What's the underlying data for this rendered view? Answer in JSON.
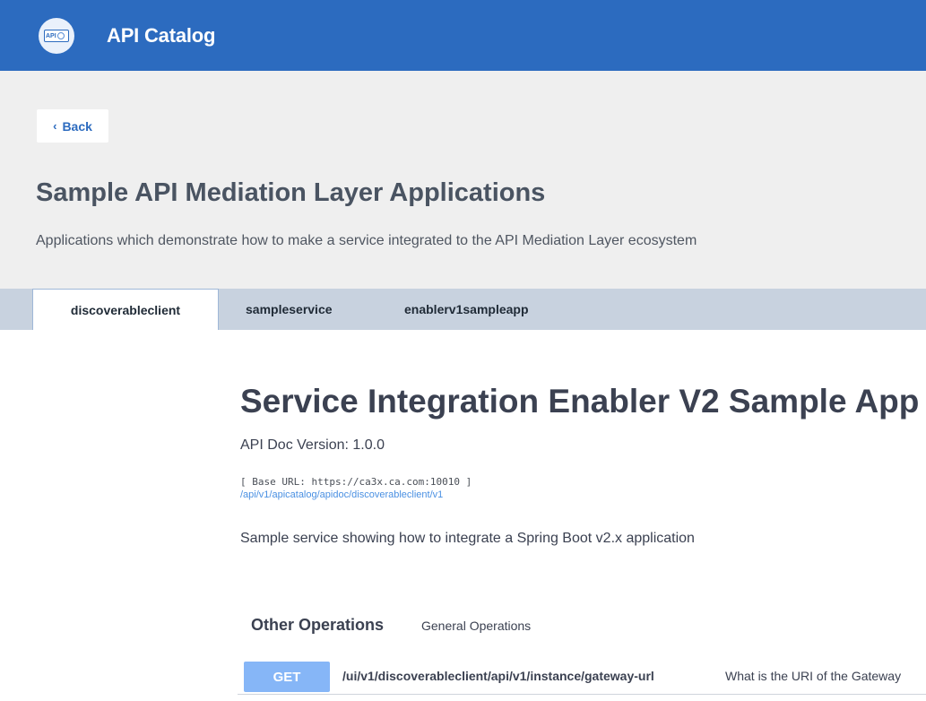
{
  "header": {
    "app_title": "API Catalog",
    "logo_text": "API",
    "bg_color": "#2c6bbf"
  },
  "nav": {
    "back_label": "Back",
    "back_icon": "chevron-left-icon"
  },
  "catalog": {
    "title": "Sample API Mediation Layer Applications",
    "description": "Applications which demonstrate how to make a service integrated to the API Mediation Layer ecosystem"
  },
  "tabs": [
    {
      "label": "discoverableclient",
      "active": true
    },
    {
      "label": "sampleservice",
      "active": false
    },
    {
      "label": "enablerv1sampleapp",
      "active": false
    }
  ],
  "service": {
    "title": "Service Integration Enabler V2 Sample App",
    "doc_version": "API Doc Version: 1.0.0",
    "base_url": "[ Base URL: https://ca3x.ca.com:10010 ]",
    "doc_link": "/api/v1/apicatalog/apidoc/discoverableclient/v1",
    "description": "Sample service showing how to integrate a Spring Boot v2.x application"
  },
  "operations_section": {
    "title": "Other Operations",
    "subtitle": "General Operations",
    "operations": [
      {
        "method": "GET",
        "method_color": "#86b6f7",
        "path": "/ui/v1/discoverableclient/api/v1/instance/gateway-url",
        "summary": "What is the URI of the Gateway"
      }
    ]
  }
}
